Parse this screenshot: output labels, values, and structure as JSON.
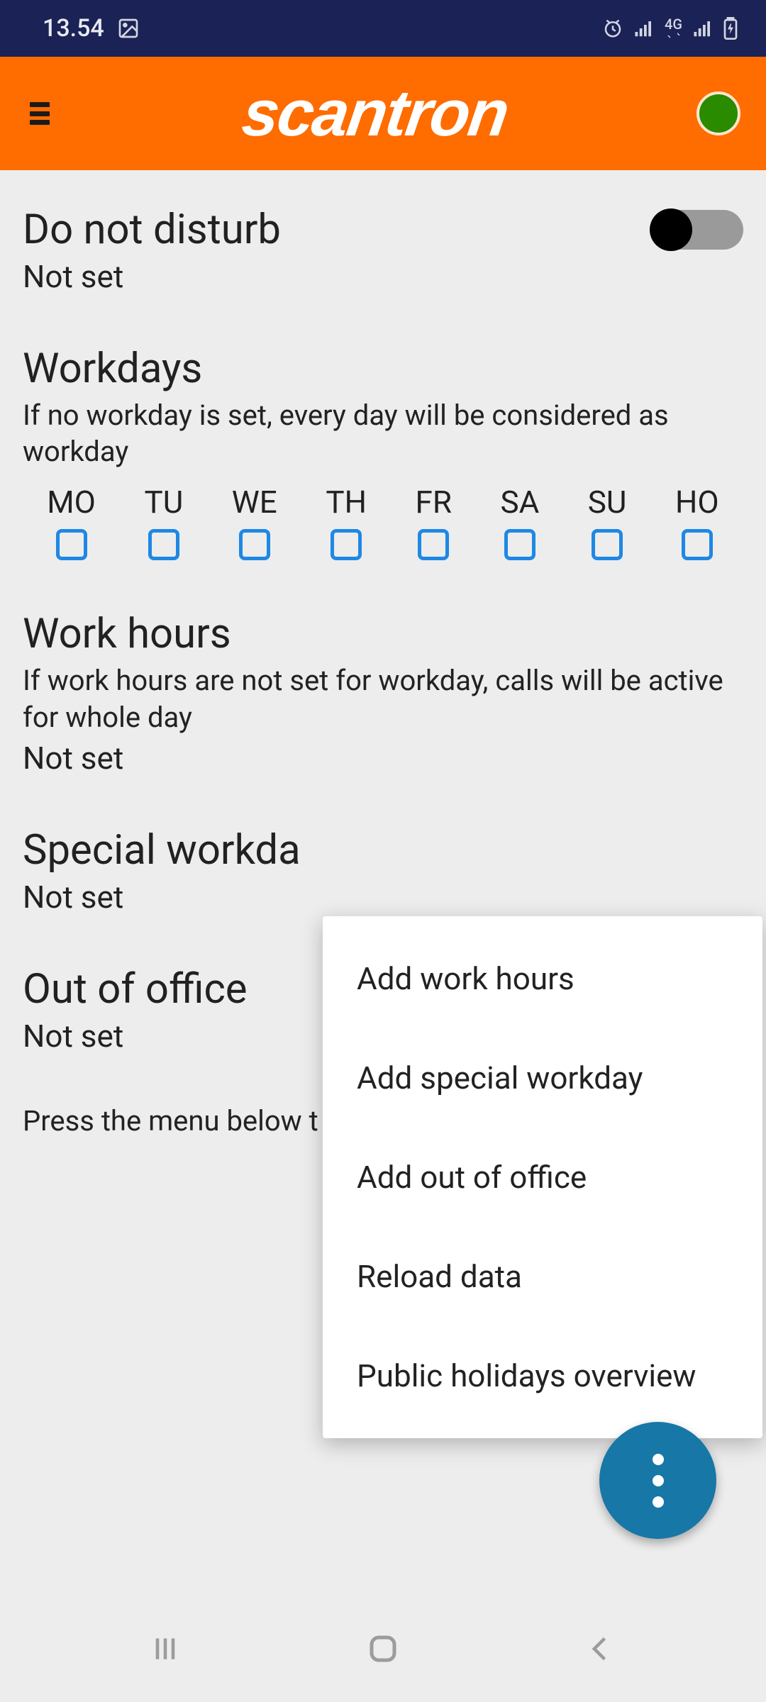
{
  "statusbar": {
    "time": "13.54",
    "network_label": "4G"
  },
  "app": {
    "brand": "scantron"
  },
  "dnd": {
    "title": "Do not disturb",
    "value": "Not set",
    "enabled": false
  },
  "workdays": {
    "title": "Workdays",
    "desc": "If no workday is set, every day will be considered as workday",
    "days": [
      {
        "label": "MO",
        "checked": false
      },
      {
        "label": "TU",
        "checked": false
      },
      {
        "label": "WE",
        "checked": false
      },
      {
        "label": "TH",
        "checked": false
      },
      {
        "label": "FR",
        "checked": false
      },
      {
        "label": "SA",
        "checked": false
      },
      {
        "label": "SU",
        "checked": false
      },
      {
        "label": "HO",
        "checked": false
      }
    ]
  },
  "workhours": {
    "title": "Work hours",
    "desc": "If work hours are not set for workday, calls will be active for whole day",
    "value": "Not set"
  },
  "special": {
    "title": "Special workda",
    "value": "Not set"
  },
  "ooo": {
    "title": "Out of office",
    "value": "Not set"
  },
  "hint": "Press the menu below t",
  "popup": {
    "items": [
      "Add work hours",
      "Add special workday",
      "Add out of office",
      "Reload data",
      "Public holidays overview"
    ]
  }
}
